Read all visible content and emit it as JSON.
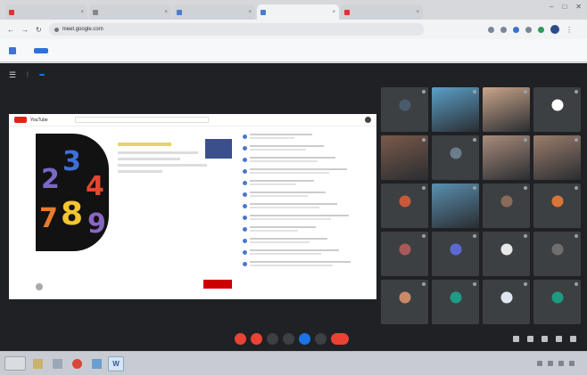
{
  "browser": {
    "tabs": [
      {
        "label": "",
        "active": false,
        "favicon": "red"
      },
      {
        "label": "",
        "active": false,
        "favicon": "gray"
      },
      {
        "label": "",
        "active": false,
        "favicon": "blue"
      },
      {
        "label": "",
        "active": true,
        "favicon": "blue"
      },
      {
        "label": "",
        "active": false,
        "favicon": "red"
      }
    ],
    "url": "meet.google.com",
    "infobar": {
      "message": "",
      "allow_label": "",
      "link_label": ""
    }
  },
  "meet": {
    "title": "",
    "subtitle": "",
    "badge": "",
    "top_right": "",
    "time": "",
    "presentation": {
      "site_name": "YouTube",
      "numbers": [
        "2",
        "3",
        "4",
        "7",
        "8",
        "9"
      ],
      "video_title": "",
      "channel": "",
      "meta": [
        "",
        "",
        "",
        ""
      ]
    },
    "participants": [
      {
        "name": "",
        "avatar_color": "#4b5a6c",
        "photo": false
      },
      {
        "name": "",
        "avatar_color": "#5aa0c8",
        "photo": true
      },
      {
        "name": "",
        "avatar_color": "#c9a58a",
        "photo": true
      },
      {
        "name": "",
        "avatar_color": "#ffffff",
        "photo": false
      },
      {
        "name": "",
        "avatar_color": "#7a5a4a",
        "photo": true
      },
      {
        "name": "",
        "avatar_color": "#6a7d8a",
        "photo": false
      },
      {
        "name": "",
        "avatar_color": "#a98c7c",
        "photo": true
      },
      {
        "name": "",
        "avatar_color": "#9b7d6c",
        "photo": true
      },
      {
        "name": "",
        "avatar_color": "#c65a3a",
        "photo": false
      },
      {
        "name": "",
        "avatar_color": "#5a8fb0",
        "photo": true
      },
      {
        "name": "",
        "avatar_color": "#8a6a5a",
        "photo": false
      },
      {
        "name": "",
        "avatar_color": "#d7763a",
        "photo": false
      },
      {
        "name": "",
        "avatar_color": "#a85a5a",
        "photo": false
      },
      {
        "name": "",
        "avatar_color": "#5a6ad0",
        "photo": false
      },
      {
        "name": "",
        "avatar_color": "#e8e8e8",
        "photo": false
      },
      {
        "name": "",
        "avatar_color": "#6f6f6f",
        "photo": false
      },
      {
        "name": "",
        "avatar_color": "#c98a6a",
        "photo": false
      },
      {
        "name": "",
        "avatar_color": "#1f9a86",
        "photo": false
      },
      {
        "name": "",
        "avatar_color": "#e0e6f0",
        "photo": false
      },
      {
        "name": "",
        "avatar_color": "#1e9a80",
        "photo": false
      }
    ]
  },
  "taskbar": {
    "start_label": "",
    "clock": ""
  }
}
